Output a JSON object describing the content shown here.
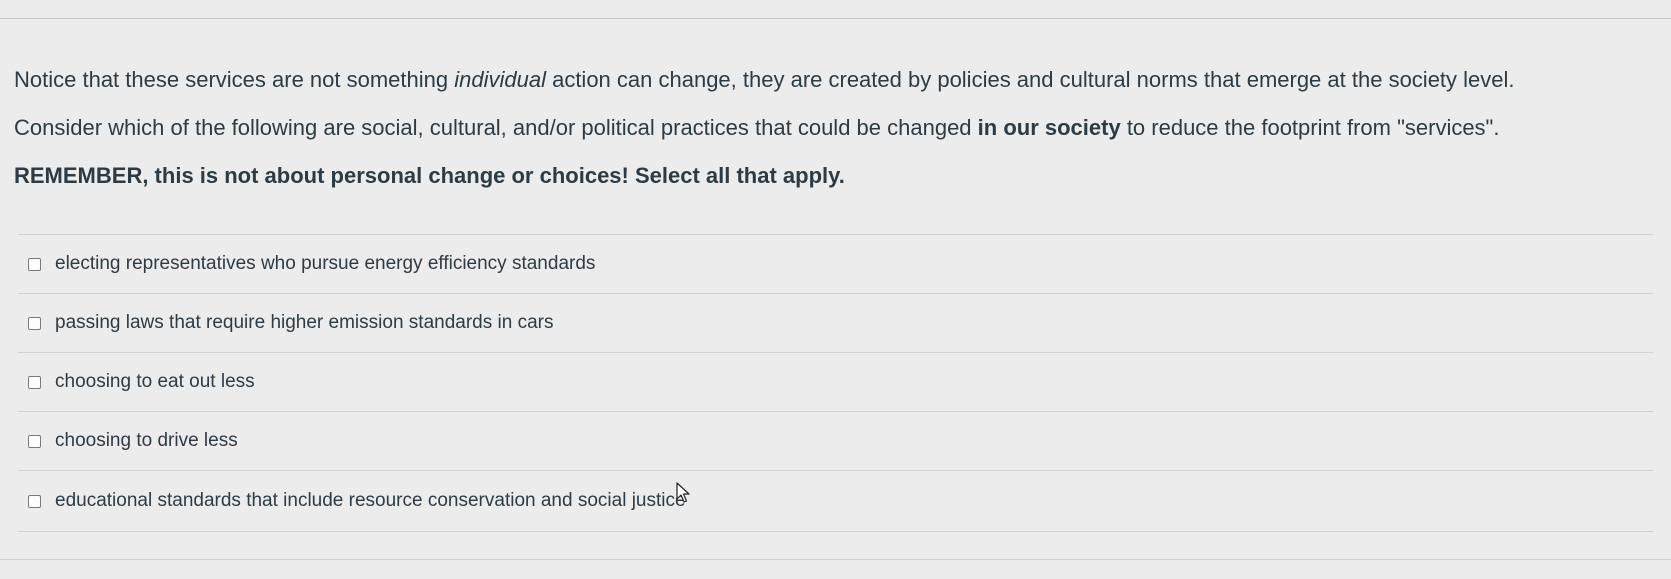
{
  "question": {
    "line1_before": "Notice that these services are not something ",
    "line1_italic": "individual",
    "line1_after": " action can change, they are created by policies and cultural norms that emerge at the society level.",
    "line2_before": "Consider which of the following are social, cultural, and/or political practices that could be changed ",
    "line2_bold": "in our society",
    "line2_after": " to reduce the footprint from \"services\".",
    "line3_bold": "REMEMBER, this is not about personal change or choices! Select all that apply."
  },
  "answers": [
    {
      "label": "electing representatives who pursue energy efficiency standards",
      "checked": false
    },
    {
      "label": "passing laws that require higher emission standards in cars",
      "checked": false
    },
    {
      "label": "choosing to eat out less",
      "checked": false
    },
    {
      "label": "choosing to drive less",
      "checked": false
    },
    {
      "label": "educational standards that include resource conservation and social justice",
      "checked": false
    }
  ],
  "icons": {
    "checkbox": "checkbox-icon",
    "cursor": "mouse-pointer-icon"
  },
  "colors": {
    "background": "#ececec",
    "text": "#2d3b45",
    "divider": "#d3d3d3"
  }
}
